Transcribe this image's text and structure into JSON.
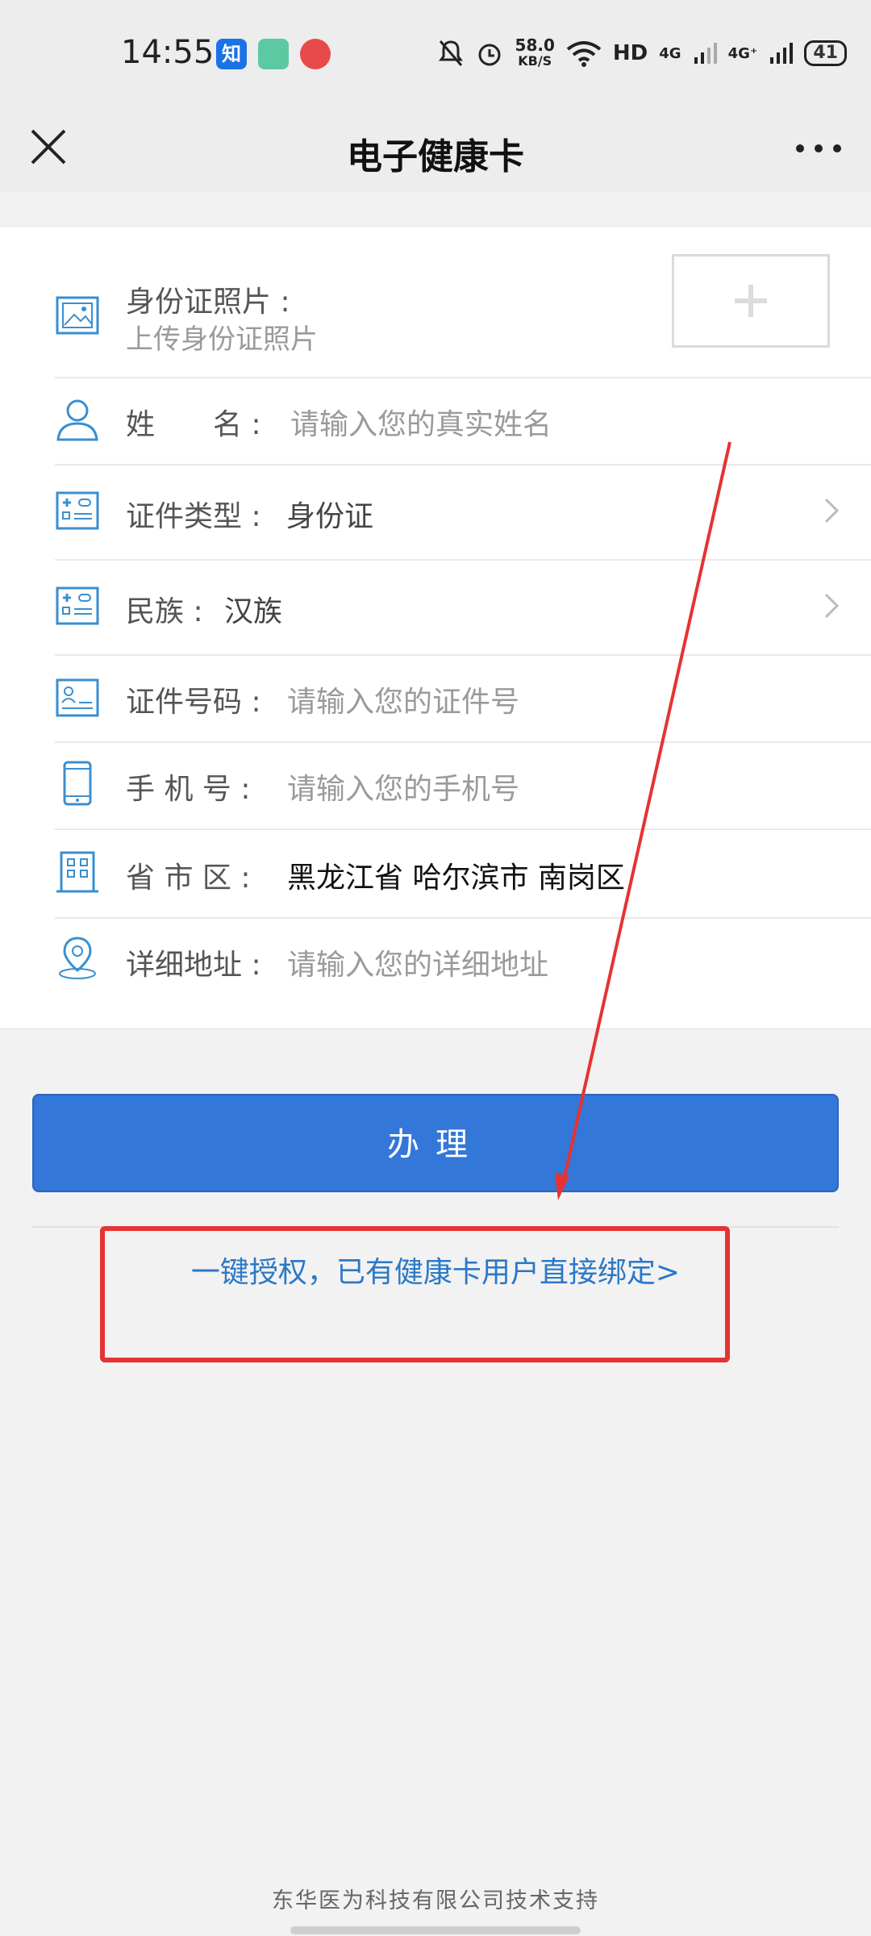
{
  "status_bar": {
    "time": "14:55",
    "apps": [
      "zhihu-app-icon",
      "chat-app-icon",
      "news-app-icon"
    ],
    "net_speed_value": "58.0",
    "net_speed_unit": "KB/S",
    "hd_label": "HD",
    "signal1_label": "4G",
    "signal2_label": "4G⁺",
    "battery": "41"
  },
  "nav": {
    "title": "电子健康卡"
  },
  "form": {
    "id_photo": {
      "label": "身份证照片 :",
      "placeholder": "上传身份证照片"
    },
    "name": {
      "label": "姓　　名 :",
      "placeholder": "请输入您的真实姓名"
    },
    "id_type": {
      "label": "证件类型 :",
      "value": "身份证"
    },
    "ethnicity": {
      "label": "民族 :",
      "value": "汉族"
    },
    "id_number": {
      "label": "证件号码 :",
      "placeholder": "请输入您的证件号"
    },
    "phone": {
      "label": "手 机 号 :",
      "placeholder": "请输入您的手机号"
    },
    "region": {
      "label": "省 市 区 :",
      "value": "黑龙江省 哈尔滨市 南岗区"
    },
    "address": {
      "label": "详细地址 :",
      "placeholder": "请输入您的详细地址"
    }
  },
  "submit_label": "办理",
  "bind_link": "一键授权，已有健康卡用户直接绑定>",
  "footer": "东华医为科技有限公司技术支持",
  "colors": {
    "primary": "#3377d8",
    "link": "#2b78c6",
    "icon": "#3a8fd0",
    "annotation": "#e53333"
  }
}
